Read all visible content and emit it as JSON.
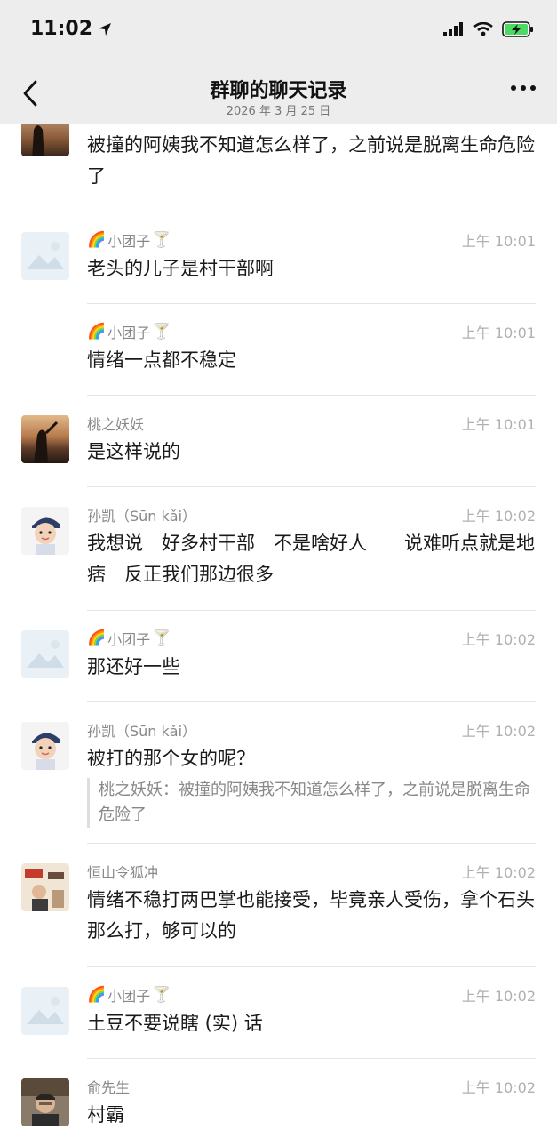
{
  "status": {
    "time": "11:02"
  },
  "nav": {
    "title": "群聊的聊天记录",
    "subtitle": "2026 年 3 月 25 日"
  },
  "messages": [
    {
      "sender": "",
      "time": "",
      "text": "被撞的阿姨我不知道怎么样了，之前说是脱离生命危险了",
      "avatar": "sunset-avatar"
    },
    {
      "sender": "小团子",
      "time": "上午 10:01",
      "text": "老头的儿子是村干部啊",
      "avatar": "placeholder-avatar"
    },
    {
      "sender": "小团子",
      "time": "上午 10:01",
      "text": "情绪一点都不稳定",
      "avatar": ""
    },
    {
      "sender": "桃之妖妖",
      "time": "上午 10:01",
      "text": "是这样说的",
      "avatar": "sunset-avatar"
    },
    {
      "sender": "孙凯（Sūn kǎi）",
      "time": "上午 10:02",
      "text": "我想说　好多村干部　不是啥好人　　说难听点就是地痞　反正我们那边很多",
      "avatar": "baby-avatar"
    },
    {
      "sender": "小团子",
      "time": "上午 10:02",
      "text": "那还好一些",
      "avatar": "placeholder-avatar"
    },
    {
      "sender": "孙凯（Sūn kǎi）",
      "time": "上午 10:02",
      "text": "被打的那个女的呢？",
      "quote": "桃之妖妖：被撞的阿姨我不知道怎么样了，之前说是脱离生命危险了",
      "avatar": "baby-avatar"
    },
    {
      "sender": "恒山令狐冲",
      "time": "上午 10:02",
      "text": "情绪不稳打两巴掌也能接受，毕竟亲人受伤，拿个石头那么打，够可以的",
      "avatar": "poster-avatar"
    },
    {
      "sender": "小团子",
      "time": "上午 10:02",
      "text": "土豆不要说瞎 (实) 话",
      "avatar": "placeholder-avatar"
    },
    {
      "sender": "俞先生",
      "time": "上午 10:02",
      "text": "村霸",
      "avatar": "man-avatar"
    }
  ],
  "emoji": {
    "rainbow": "🌈",
    "cocktail": "🍸"
  }
}
